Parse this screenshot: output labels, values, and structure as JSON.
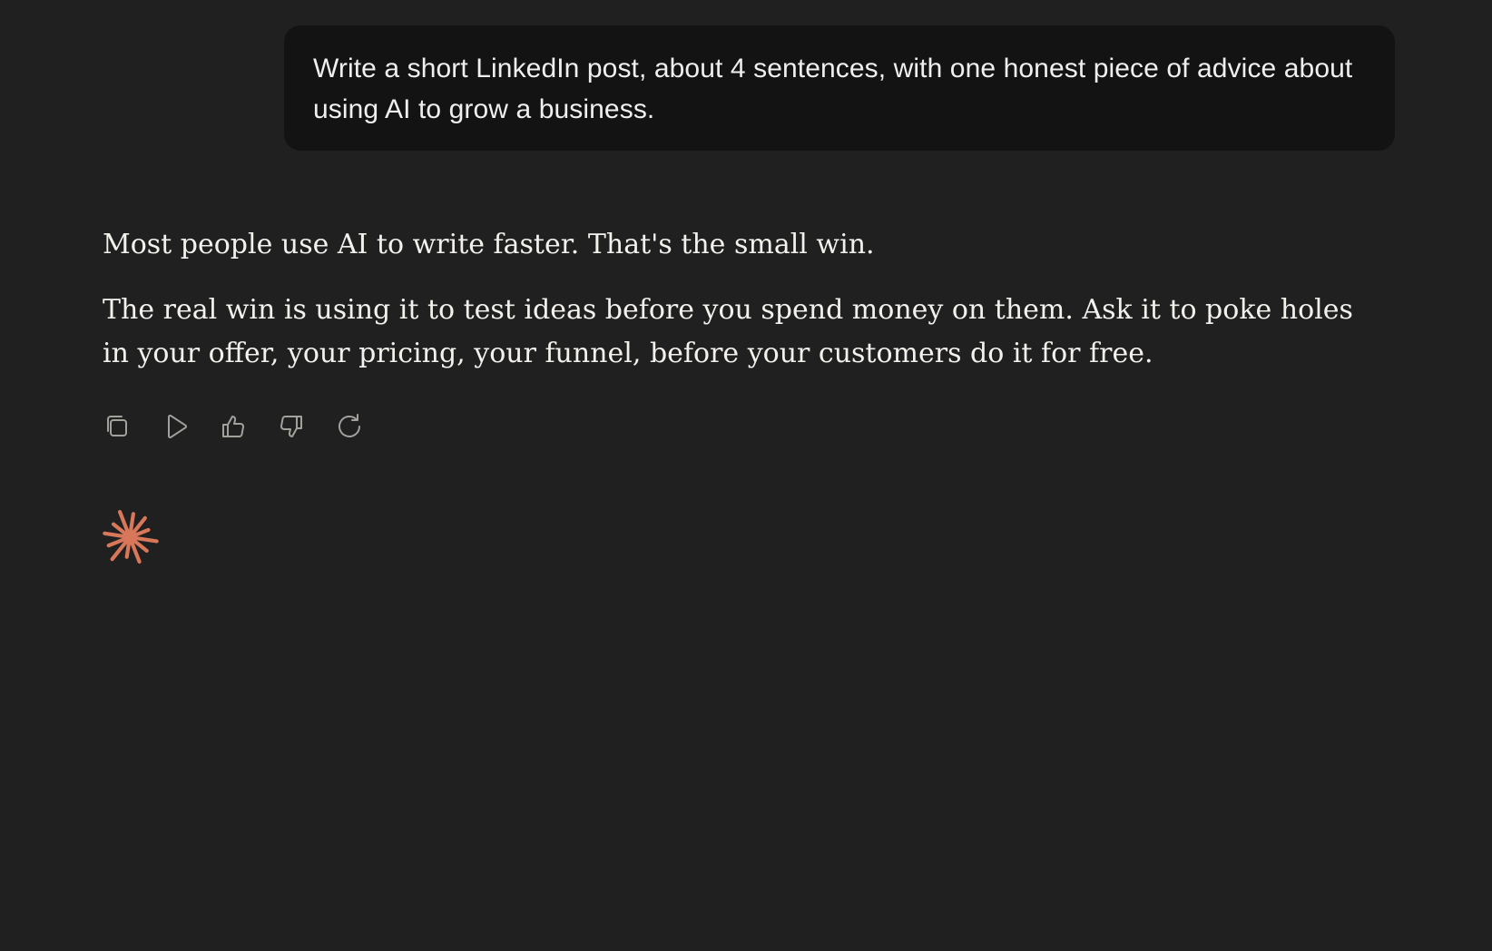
{
  "conversation": {
    "user_message": "Write a short LinkedIn post, about 4 sentences, with one honest piece of advice about using AI to grow a business.",
    "assistant_paragraphs": [
      "Most people use AI to write faster. That's the small win.",
      "The real win is using it to test ideas before you spend money on them. Ask it to poke holes in your offer, your pricing, your funnel, before your customers do it for free."
    ]
  },
  "actions": [
    {
      "icon": "copy-icon"
    },
    {
      "icon": "play-icon"
    },
    {
      "icon": "thumbs-up-icon"
    },
    {
      "icon": "thumbs-down-icon"
    },
    {
      "icon": "retry-icon"
    }
  ],
  "colors": {
    "background": "#202020",
    "user_bubble": "#131313",
    "text": "#f2f1ec",
    "icon": "#a3a19c",
    "accent_spark": "#d9775a"
  },
  "indicator": {
    "icon": "spark-icon"
  }
}
